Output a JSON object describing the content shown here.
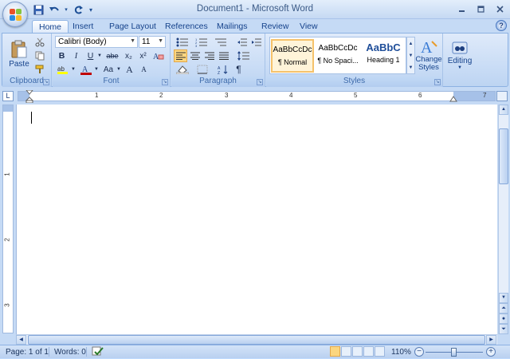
{
  "window": {
    "title": "Document1 - Microsoft Word",
    "controls": [
      "minimize-icon",
      "maximize-icon",
      "close-icon"
    ]
  },
  "quick_access": {
    "items": [
      "save-icon",
      "undo-icon",
      "redo-icon",
      "customize-icon"
    ]
  },
  "tabs": [
    {
      "label": "Home",
      "active": true
    },
    {
      "label": "Insert"
    },
    {
      "label": "Page Layout"
    },
    {
      "label": "References"
    },
    {
      "label": "Mailings"
    },
    {
      "label": "Review"
    },
    {
      "label": "View"
    }
  ],
  "ribbon": {
    "clipboard": {
      "label": "Clipboard",
      "paste_label": "Paste"
    },
    "font": {
      "label": "Font",
      "font_name": "Calibri (Body)",
      "font_size": "11",
      "bold": "B",
      "italic": "I",
      "underline": "U",
      "strike": "abe",
      "subscript": "x₂",
      "superscript": "x²",
      "change_case": "Aa",
      "grow": "A",
      "shrink": "A"
    },
    "paragraph": {
      "label": "Paragraph",
      "show_marks": "¶"
    },
    "styles": {
      "label": "Styles",
      "items": [
        {
          "sample": "AaBbCcDc",
          "name": "¶ Normal",
          "selected": true
        },
        {
          "sample": "AaBbCcDc",
          "name": "¶ No Spaci..."
        },
        {
          "sample": "AaBbC",
          "name": "Heading 1"
        }
      ],
      "change_styles_label": "Change Styles"
    },
    "editing": {
      "label": "Editing"
    }
  },
  "ruler": {
    "numbers": [
      "1",
      "2",
      "3",
      "4",
      "5",
      "6",
      "7"
    ],
    "vnumbers": [
      "1",
      "2",
      "3"
    ],
    "tab_selector": "L"
  },
  "status": {
    "page": "Page: 1 of 1",
    "words": "Words: 0",
    "zoom": "110%",
    "zoom_level_percent": 110,
    "active_view": "print-layout"
  },
  "colors": {
    "accent": "#15428b",
    "ribbon_bg": "#dfeafa",
    "highlight": "#f5c26b"
  }
}
